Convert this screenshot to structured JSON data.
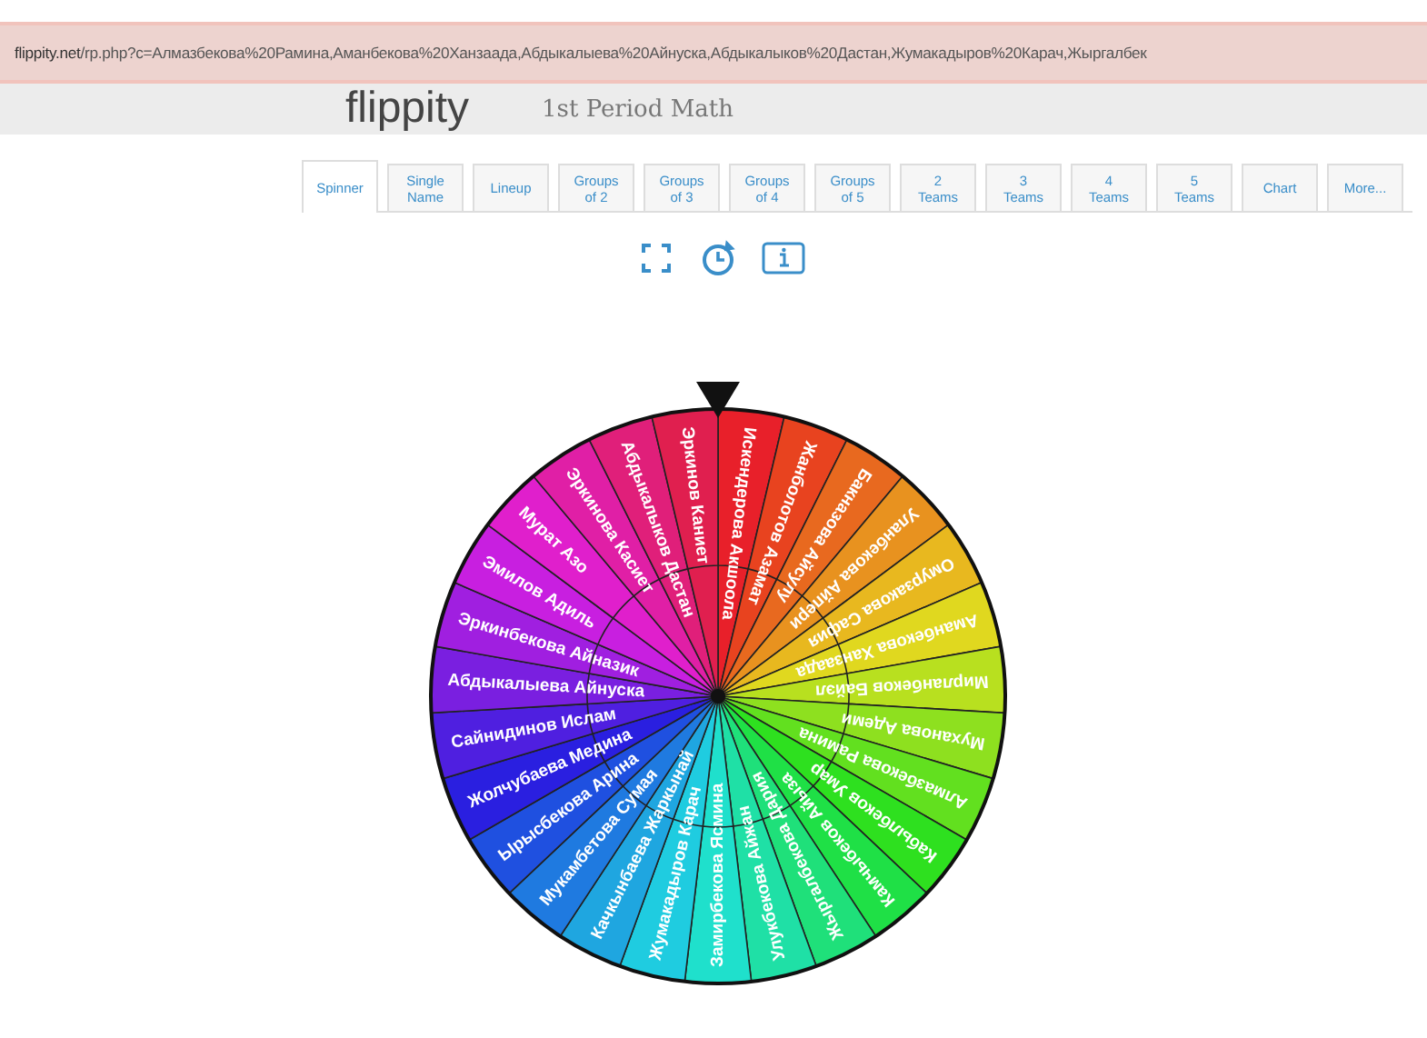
{
  "address_bar": {
    "host": "flippity.net",
    "path": "/rp.php?c=Алмазбекова%20Рамина,Аманбекова%20Ханзаада,Абдыкалыева%20Айнуска,Абдыкалыков%20Дастан,Жумакадыров%20Карач,Жыргалбек"
  },
  "header": {
    "logo": "flippity",
    "title": "1st Period Math"
  },
  "tabs": [
    {
      "label": "Spinner",
      "selected": true
    },
    {
      "label": "Single\nName",
      "selected": false
    },
    {
      "label": "Lineup",
      "selected": false
    },
    {
      "label": "Groups\nof 2",
      "selected": false
    },
    {
      "label": "Groups\nof 3",
      "selected": false
    },
    {
      "label": "Groups\nof 4",
      "selected": false
    },
    {
      "label": "Groups\nof 5",
      "selected": false
    },
    {
      "label": "2\nTeams",
      "selected": false
    },
    {
      "label": "3\nTeams",
      "selected": false
    },
    {
      "label": "4\nTeams",
      "selected": false
    },
    {
      "label": "5\nTeams",
      "selected": false
    },
    {
      "label": "Chart",
      "selected": false
    },
    {
      "label": "More...",
      "selected": false
    }
  ],
  "toolbar": [
    {
      "kind": "fullscreen"
    },
    {
      "kind": "timer"
    },
    {
      "kind": "info"
    }
  ],
  "wheel": {
    "slices": [
      {
        "name": "Искендерова Акшоола",
        "color": "#e8202a"
      },
      {
        "name": "Жанболотов Азамат",
        "color": "#e8431f"
      },
      {
        "name": "Бакназова Айсулу",
        "color": "#e8691f"
      },
      {
        "name": "Уланбекова Айпери",
        "color": "#e8921f"
      },
      {
        "name": "Омурзакова Сафия",
        "color": "#e8b81f"
      },
      {
        "name": "Аманбекова Ханзаада",
        "color": "#e0d81f"
      },
      {
        "name": "Мирланбеков Байэл",
        "color": "#b8e01f"
      },
      {
        "name": "Муханова Адеми",
        "color": "#8ee01f"
      },
      {
        "name": "Алмазбекова Рамина",
        "color": "#62e01f"
      },
      {
        "name": "Кабылбеков Умар",
        "color": "#2ee01f"
      },
      {
        "name": "Камчыбеков Айыза",
        "color": "#1fe046"
      },
      {
        "name": "Жыргалбекова Дария",
        "color": "#1fe07a"
      },
      {
        "name": "Улукбекова Айжан",
        "color": "#1fe0a6"
      },
      {
        "name": "Замирбекова Ясмина",
        "color": "#1fe0cc"
      },
      {
        "name": "Жумакадыров Карач",
        "color": "#1fcce0"
      },
      {
        "name": "Качкынбаева Жаркынай",
        "color": "#1fa6e0"
      },
      {
        "name": "Мукамбетова Сумая",
        "color": "#1f7ae0"
      },
      {
        "name": "Ырысбекова Арина",
        "color": "#1f50e0"
      },
      {
        "name": "Жолчубаева Медина",
        "color": "#2a1fe0"
      },
      {
        "name": "Сайнидинов Ислам",
        "color": "#4f1fe0"
      },
      {
        "name": "Абдыкалыева Айнуска",
        "color": "#7a1fe0"
      },
      {
        "name": "Эркинбекова Айназик",
        "color": "#a01fe0"
      },
      {
        "name": "Эмилов Адиль",
        "color": "#c81fe0"
      },
      {
        "name": "Мурат Азо",
        "color": "#e01fcc"
      },
      {
        "name": "Эркинова Касиет",
        "color": "#e01fa6"
      },
      {
        "name": "Абдыкалыков Дастан",
        "color": "#e01f7a"
      },
      {
        "name": "Эркинов Каниет",
        "color": "#e01f4f"
      }
    ]
  }
}
